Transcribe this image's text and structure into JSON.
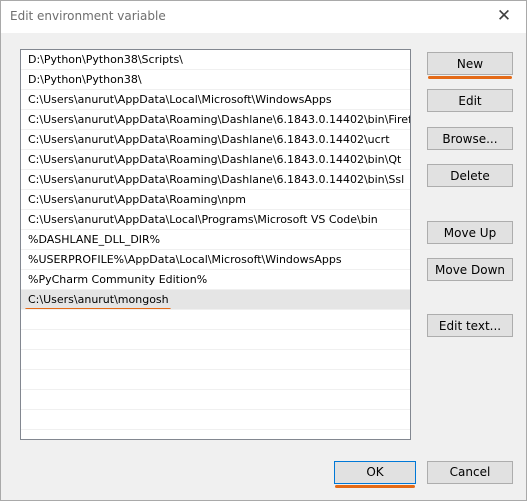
{
  "window": {
    "title": "Edit environment variable",
    "close_label": "✕"
  },
  "paths": [
    "D:\\Python\\Python38\\Scripts\\",
    "D:\\Python\\Python38\\",
    "C:\\Users\\anurut\\AppData\\Local\\Microsoft\\WindowsApps",
    "C:\\Users\\anurut\\AppData\\Roaming\\Dashlane\\6.1843.0.14402\\bin\\Firef...",
    "C:\\Users\\anurut\\AppData\\Roaming\\Dashlane\\6.1843.0.14402\\ucrt",
    "C:\\Users\\anurut\\AppData\\Roaming\\Dashlane\\6.1843.0.14402\\bin\\Qt",
    "C:\\Users\\anurut\\AppData\\Roaming\\Dashlane\\6.1843.0.14402\\bin\\Ssl",
    "C:\\Users\\anurut\\AppData\\Roaming\\npm",
    "C:\\Users\\anurut\\AppData\\Local\\Programs\\Microsoft VS Code\\bin",
    "%DASHLANE_DLL_DIR%",
    "%USERPROFILE%\\AppData\\Local\\Microsoft\\WindowsApps",
    "%PyCharm Community Edition%",
    "C:\\Users\\anurut\\mongosh"
  ],
  "buttons": {
    "new": "New",
    "edit": "Edit",
    "browse": "Browse...",
    "delete": "Delete",
    "move_up": "Move Up",
    "move_down": "Move Down",
    "edit_text": "Edit text...",
    "ok": "OK",
    "cancel": "Cancel"
  },
  "colors": {
    "highlight": "#e46a17",
    "selected_row": "#e5e5e5"
  }
}
